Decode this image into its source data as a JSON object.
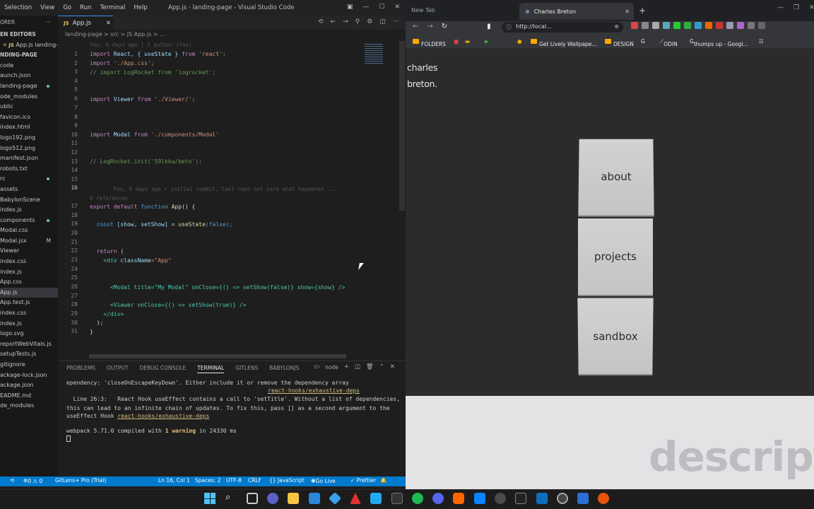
{
  "vscode": {
    "menu": [
      "Selection",
      "View",
      "Go",
      "Run",
      "Terminal",
      "Help"
    ],
    "window_title": "App.js - landing-page - Visual Studio Code",
    "explorer": {
      "header_left": "ORER",
      "header_editors": "EN EDITORS",
      "open_file": "App.js landing-p...",
      "project": "NDING-PAGE",
      "items": [
        {
          "label": "code"
        },
        {
          "label": "aunch.json"
        },
        {
          "label": "landing-page",
          "dot": true
        },
        {
          "label": "ode_modules"
        },
        {
          "label": "ublic"
        },
        {
          "label": "favicon.ico"
        },
        {
          "label": "index.html"
        },
        {
          "label": "logo192.png"
        },
        {
          "label": "logo512.png"
        },
        {
          "label": "manifest.json"
        },
        {
          "label": "robots.txt"
        },
        {
          "label": "rc",
          "dot": true
        },
        {
          "label": "assets"
        },
        {
          "label": "BabylonScene"
        },
        {
          "label": "index.js"
        },
        {
          "label": "components",
          "dot": true
        },
        {
          "label": "Modal.css"
        },
        {
          "label": "Modal.jsx",
          "mark": "M"
        },
        {
          "label": "Viewer"
        },
        {
          "label": "index.css"
        },
        {
          "label": "index.js"
        },
        {
          "label": "App.css"
        },
        {
          "label": "App.js",
          "selected": true
        },
        {
          "label": "App.test.js"
        },
        {
          "label": "index.css"
        },
        {
          "label": "index.js"
        },
        {
          "label": "logo.svg"
        },
        {
          "label": "reportWebVitals.js"
        },
        {
          "label": "setupTests.js"
        },
        {
          "label": "gitignore"
        },
        {
          "label": "ackage-lock.json"
        },
        {
          "label": "ackage.json"
        },
        {
          "label": "EADME.md"
        },
        {
          "label": "de_modules"
        }
      ]
    },
    "tab_label": "App.js",
    "breadcrumb": "landing-page > src > JS App.js > ...",
    "blame_header": "You, 6 days ago | 1 author (You)",
    "blame_line16": "You, 6 days ago • initial commit, last repo not sure what happened ...",
    "references": "0 references",
    "line_numbers": [
      "1",
      "2",
      "3",
      "4",
      "5",
      "6",
      "7",
      "8",
      "9",
      "10",
      "11",
      "12",
      "13",
      "14",
      "15",
      "16",
      "17",
      "18",
      "19",
      "20",
      "21",
      "22",
      "23",
      "24",
      "25",
      "26",
      "27",
      "28",
      "29",
      "30",
      "31"
    ],
    "code": {
      "l1a": "import",
      "l1b": " React, { useState } ",
      "l1c": "from",
      "l1d": " 'react';",
      "l2a": "import",
      "l2b": " './App.css';",
      "l3": "// import LogRocket from 'logrocket';",
      "l6a": "import",
      "l6b": " Viewer ",
      "l6c": "from",
      "l6d": " './Viewer/';",
      "l10a": "import",
      "l10b": " Modal ",
      "l10c": "from",
      "l10d": " './components/Modal'",
      "l13": "// LogRocket.init('59lkkw/beto');",
      "l17a": "export default",
      "l17b": " function ",
      "l17c": "App",
      "l17d": "() {",
      "l19a": "  const ",
      "l19b": "[show, setShow]",
      "l19c": " = ",
      "l19d": "useState",
      "l19e": "(false);",
      "l22a": "  return",
      "l22b": " (",
      "l23a": "    <div ",
      "l23b": "className",
      "l23c": "=\"App\"",
      ">": ">",
      "l26": "      <Modal title=\"My Modal\" onClose={() => setShow(false)} show={show} />",
      "l28": "      <Viewer onClose={() => setShow(true)} />",
      "l29": "    </div>",
      "l30": "  );",
      "l31": "}"
    },
    "panel": {
      "tabs": [
        "PROBLEMS",
        "OUTPUT",
        "DEBUG CONSOLE",
        "TERMINAL",
        "GITLENS",
        "BABYLONJS"
      ],
      "active_tab": "TERMINAL",
      "shell": "node",
      "t1": "ependency: 'closeOnEscapeKeyDown'. Either include it or remove the dependency array",
      "t1link": "react-hooks/exhaustive-deps",
      "t2": "  Line 26:3:   React Hook useEffect contains a call to 'setTitle'. Without a list of dependencies,",
      "t3": "this can lead to an infinite chain of updates. To fix this, pass [] as a second argument to the useEffect Hook",
      "t3link": "react-hooks/exhaustive-deps",
      "t4a": "webpack 5.71.0 compiled with ",
      "t4b": "1 warning",
      "t4c": " in 24330 ms"
    },
    "status": {
      "errors": "0 ⚠ 0",
      "gitlens": "GitLens+ Pro (Trial)",
      "position": "Ln 16, Col 1",
      "spaces": "Spaces: 2",
      "encoding": "UTF-8",
      "eol": "CRLF",
      "language": "{} JavaScript",
      "golive": "Go Live",
      "prettier": "✓ Prettier"
    }
  },
  "browser": {
    "tab1": "New Tab",
    "tab2": "Charles Breton",
    "url": "http://local...",
    "bookmarks": [
      "FOLDERS",
      "Get Lively Wallpape...",
      "DESIGN",
      "ODIN",
      "thumps up - Googl..."
    ],
    "page": {
      "brand_line1": "charles",
      "brand_line2": "breton.",
      "buttons": [
        "about",
        "projects",
        "sandbox"
      ],
      "watermark": "descript"
    }
  }
}
